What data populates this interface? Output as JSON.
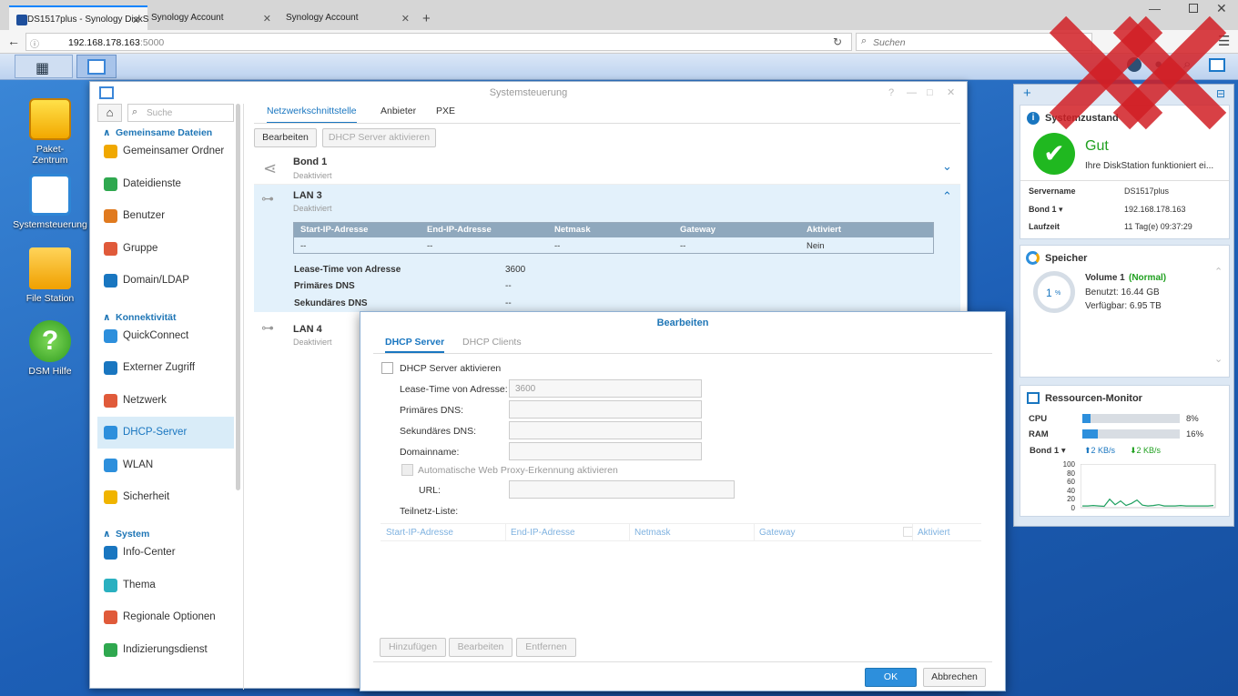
{
  "browser": {
    "tabs": [
      {
        "title": "DS1517plus - Synology DiskS"
      },
      {
        "title": "Synology Account"
      },
      {
        "title": "Synology Account"
      }
    ],
    "url_host": "192.168.178.163",
    "url_port": ":5000",
    "search_placeholder": "Suchen"
  },
  "desktop": {
    "icons": [
      {
        "label": "Paket-\nZentrum"
      },
      {
        "label": "Systemsteuerung"
      },
      {
        "label": "File Station"
      },
      {
        "label": "DSM Hilfe"
      }
    ]
  },
  "cp": {
    "title": "Systemsteuerung",
    "search_placeholder": "Suche",
    "sections": {
      "shared": "Gemeinsame Dateien",
      "conn": "Konnektivität",
      "system": "System"
    },
    "items": [
      "Gemeinsamer Ordner",
      "Dateidienste",
      "Benutzer",
      "Gruppe",
      "Domain/LDAP",
      "QuickConnect",
      "Externer Zugriff",
      "Netzwerk",
      "DHCP-Server",
      "WLAN",
      "Sicherheit",
      "Info-Center",
      "Thema",
      "Regionale Optionen",
      "Indizierungsdienst"
    ],
    "tabs": [
      "Netzwerkschnittstelle",
      "Anbieter",
      "PXE"
    ],
    "buttons": {
      "edit": "Bearbeiten",
      "enable": "DHCP Server aktivieren"
    },
    "interfaces": [
      {
        "name": "Bond 1",
        "status": "Deaktiviert"
      },
      {
        "name": "LAN 3",
        "status": "Deaktiviert"
      },
      {
        "name": "LAN 4",
        "status": "Deaktiviert"
      }
    ],
    "table": {
      "headers": [
        "Start-IP-Adresse",
        "End-IP-Adresse",
        "Netmask",
        "Gateway",
        "Aktiviert"
      ],
      "row": [
        "--",
        "--",
        "--",
        "--",
        "Nein"
      ]
    },
    "details": [
      {
        "label": "Lease-Time von Adresse",
        "value": "3600"
      },
      {
        "label": "Primäres DNS",
        "value": "--"
      },
      {
        "label": "Sekundäres DNS",
        "value": "--"
      }
    ]
  },
  "widgets": {
    "health": {
      "title": "Systemzustand",
      "status": "Gut",
      "msg": "Ihre DiskStation funktioniert ei...",
      "rows": [
        {
          "k": "Servername",
          "v": "DS1517plus"
        },
        {
          "k": "Bond 1 ▾",
          "v": "192.168.178.163"
        },
        {
          "k": "Laufzeit",
          "v": "11 Tag(e) 09:37:29"
        }
      ]
    },
    "storage": {
      "title": "Speicher",
      "percent": "1",
      "unit": "%",
      "volume": "Volume 1",
      "state": "(Normal)",
      "used": "Benutzt: 16.44 GB",
      "free": "Verfügbar: 6.95 TB"
    },
    "monitor": {
      "title": "Ressourcen-Monitor",
      "cpu_label": "CPU",
      "cpu": 8,
      "cpu_text": "8%",
      "ram_label": "RAM",
      "ram": 16,
      "ram_text": "16%",
      "net_label": "Bond 1 ▾",
      "up": "2 KB/s",
      "down": "2 KB/s",
      "axis": [
        "100",
        "80",
        "60",
        "40",
        "20",
        "0"
      ],
      "series": [
        2,
        2,
        3,
        2,
        1,
        18,
        5,
        14,
        3,
        8,
        16,
        4,
        2,
        3,
        5,
        2,
        2,
        2,
        3,
        2,
        2,
        2,
        2,
        2,
        3
      ]
    }
  },
  "dialog": {
    "title": "Bearbeiten",
    "tabs": [
      "DHCP Server",
      "DHCP Clients"
    ],
    "enable": "DHCP Server aktivieren",
    "fields": [
      {
        "label": "Lease-Time von Adresse:",
        "value": "3600"
      },
      {
        "label": "Primäres DNS:",
        "value": ""
      },
      {
        "label": "Sekundäres DNS:",
        "value": ""
      },
      {
        "label": "Domainname:",
        "value": ""
      }
    ],
    "proxy": "Automatische Web Proxy-Erkennung aktivieren",
    "url_label": "URL:",
    "subnet": "Teilnetz-Liste:",
    "grid": [
      "Start-IP-Adresse",
      "End-IP-Adresse",
      "Netmask",
      "Gateway",
      "Aktiviert"
    ],
    "buttons": {
      "add": "Hinzufügen",
      "edit": "Bearbeiten",
      "remove": "Entfernen",
      "ok": "OK",
      "cancel": "Abbrechen"
    }
  },
  "colors": {
    "accent": "#1976c0",
    "ok": "#20b820",
    "bar": "#2d8fdc"
  }
}
